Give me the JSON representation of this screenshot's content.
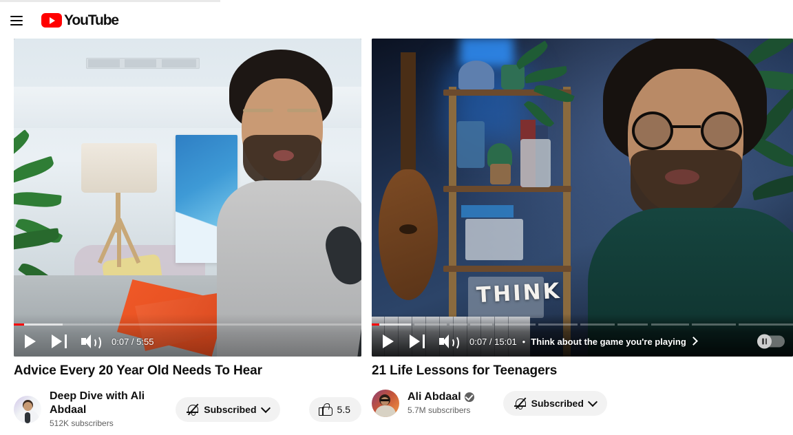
{
  "masthead": {
    "guide_icon": "hamburger-menu-icon",
    "logo_icon": "youtube-logo-icon",
    "logo_text": "YouTube"
  },
  "videos": [
    {
      "id": "left",
      "player": {
        "play_icon": "play-icon",
        "next_icon": "next-track-icon",
        "volume_icon": "volume-on-icon",
        "time_text": "0:07 / 5:55",
        "current_time": "0:07",
        "duration": "5:55",
        "progress_percent": 2,
        "buffer_percent": 14,
        "has_chapters": false,
        "has_autoplay_toggle": false
      },
      "title": "Advice Every 20 Year Old Needs To Hear",
      "channel": {
        "name": "Deep Dive with Ali Abdaal",
        "verified": false,
        "subscribers": "512K subscribers",
        "avatar_icon": "channel-avatar"
      },
      "subscribe_button": {
        "label": "Subscribed",
        "bell_icon": "bell-off-icon",
        "chevron_icon": "chevron-down-icon"
      },
      "like_button": {
        "count": "5.5",
        "thumb_icon": "thumbs-up-icon"
      }
    },
    {
      "id": "right",
      "player": {
        "play_icon": "play-icon",
        "next_icon": "next-track-icon",
        "volume_icon": "volume-on-icon",
        "time_text": "0:07 / 15:01",
        "current_time": "0:07",
        "duration": "15:01",
        "chapter_separator": "•",
        "chapter_title": "Think about the game you're playing",
        "chapter_chevron_icon": "chevron-right-icon",
        "progress_percent": 1,
        "buffer_percent": 13,
        "has_chapters": true,
        "has_autoplay_toggle": true,
        "autoplay_icon": "pause-icon",
        "caption_overlay": "THINK"
      },
      "title": "21 Life Lessons for Teenagers",
      "channel": {
        "name": "Ali Abdaal",
        "verified": true,
        "verified_icon": "verified-badge-icon",
        "subscribers": "5.7M subscribers",
        "avatar_icon": "channel-avatar"
      },
      "subscribe_button": {
        "label": "Subscribed",
        "bell_icon": "bell-off-icon",
        "chevron_icon": "chevron-down-icon"
      }
    }
  ],
  "colors": {
    "brand_red": "#FF0000",
    "text_primary": "#0f0f0f",
    "text_secondary": "#606060",
    "chip_bg": "#f2f2f2"
  }
}
